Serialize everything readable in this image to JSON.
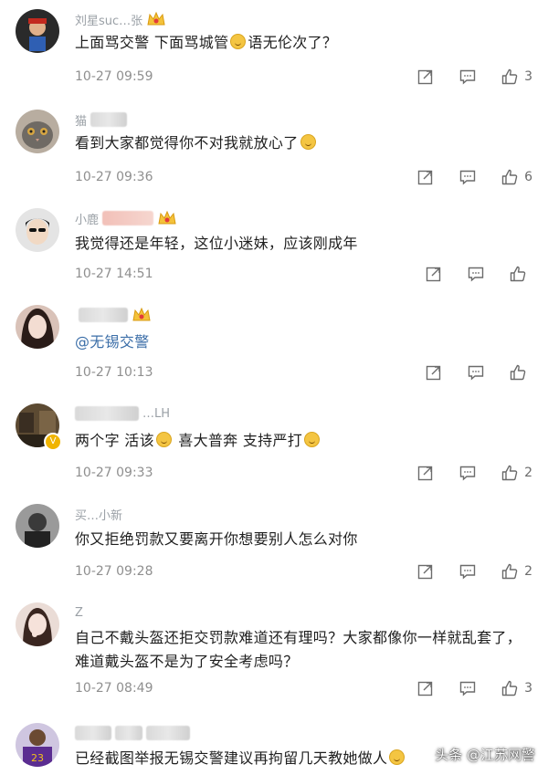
{
  "comments": [
    {
      "name": "刘星suc…张",
      "text_parts": [
        "上面骂交警 下面骂城管",
        "语无伦次了？"
      ],
      "time": "10-27 09:59",
      "likes": "3",
      "avatar_color": "#3a3a3a"
    },
    {
      "name": "猫",
      "text_parts": [
        "看到大家都觉得你不对我就放心了",
        ""
      ],
      "time": "10-27 09:36",
      "likes": "6",
      "avatar_color": "#8a7a6a"
    },
    {
      "name": "小鹿",
      "text_parts": [
        "我觉得还是年轻，这位小迷妹，应该刚成年"
      ],
      "time": "10-27 14:51",
      "likes": "",
      "avatar_color": "#d8d8d8"
    },
    {
      "name": "",
      "text_parts": [
        "@无锡交警"
      ],
      "time": "10-27 10:13",
      "likes": "",
      "avatar_color": "#c9a89a"
    },
    {
      "name": "…LH",
      "text_parts": [
        "两个字 活该",
        "喜大普奔 支持严打",
        ""
      ],
      "time": "10-27 09:33",
      "likes": "2",
      "avatar_color": "#6b5a3a"
    },
    {
      "name": "买…小新",
      "text_parts": [
        "你又拒绝罚款又要离开你想要别人怎么对你"
      ],
      "time": "10-27 09:28",
      "likes": "2",
      "avatar_color": "#4a4a4a"
    },
    {
      "name": "Z",
      "text_parts": [
        "自己不戴头盔还拒交罚款难道还有理吗？大家都像你一样就乱套了，难道戴头盔不是为了安全考虑吗？"
      ],
      "time": "10-27 08:49",
      "likes": "3",
      "avatar_color": "#e8d2c8"
    },
    {
      "name": "",
      "text_parts": [
        "已经截图举报无锡交警建议再拘留几天教她做人",
        ""
      ],
      "time": "",
      "likes": "",
      "avatar_color": "#5a3a8a"
    }
  ],
  "watermark": "头条 @江苏网警",
  "badge_v": "V",
  "avatar_jersey": "23"
}
